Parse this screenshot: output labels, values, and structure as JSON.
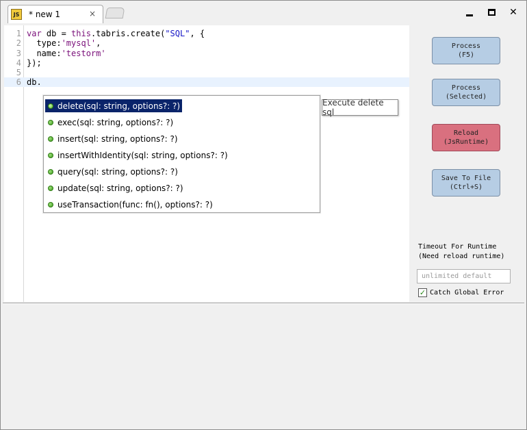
{
  "tab": {
    "icon_text": "JS",
    "title": "* new 1",
    "close": "×"
  },
  "window_controls": {
    "close": "✕"
  },
  "editor": {
    "line_numbers": [
      "1",
      "2",
      "3",
      "4",
      "5",
      "6"
    ],
    "lines": [
      [
        {
          "t": "var",
          "c": "kw"
        },
        {
          "t": " db = ",
          "c": ""
        },
        {
          "t": "this",
          "c": "kw"
        },
        {
          "t": ".tabris.create(",
          "c": ""
        },
        {
          "t": "\"SQL\"",
          "c": "str"
        },
        {
          "t": ", {",
          "c": ""
        }
      ],
      [
        {
          "t": "  type:",
          "c": ""
        },
        {
          "t": "'mysql'",
          "c": "strp"
        },
        {
          "t": ",",
          "c": ""
        }
      ],
      [
        {
          "t": "  name:",
          "c": ""
        },
        {
          "t": "'testorm'",
          "c": "strp"
        }
      ],
      [
        {
          "t": "});",
          "c": ""
        }
      ],
      [
        {
          "t": "",
          "c": ""
        }
      ],
      [
        {
          "t": "db.",
          "c": ""
        }
      ]
    ],
    "active_line": 6
  },
  "autocomplete": {
    "items": [
      "delete(sql: string, options?: ?)",
      "exec(sql: string, options?: ?)",
      "insert(sql: string, options?: ?)",
      "insertWithIdentity(sql: string, options?: ?)",
      "query(sql: string, options?: ?)",
      "update(sql: string, options?: ?)",
      "useTransaction(func: fn(), options?: ?)"
    ],
    "selected_index": 0,
    "tooltip": "Execute delete sql"
  },
  "side_panel": {
    "process": {
      "line1": "Process",
      "line2": "(F5)"
    },
    "process_selected": {
      "line1": "Process",
      "line2": "(Selected)"
    },
    "reload": {
      "line1": "Reload",
      "line2": "(JsRuntime)"
    },
    "save": {
      "line1": "Save To File",
      "line2": "(Ctrl+S)"
    },
    "timeout_label": "Timeout For Runtime\n(Need reload runtime)",
    "timeout_placeholder": "unlimited default",
    "catch_label": "Catch Global Error",
    "catch_checked": true
  },
  "colors": {
    "button_blue": "#b6cde4",
    "button_red": "#d9707f",
    "selection": "#0a246a",
    "keyword": "#7a0f7a",
    "string": "#1515c6"
  }
}
